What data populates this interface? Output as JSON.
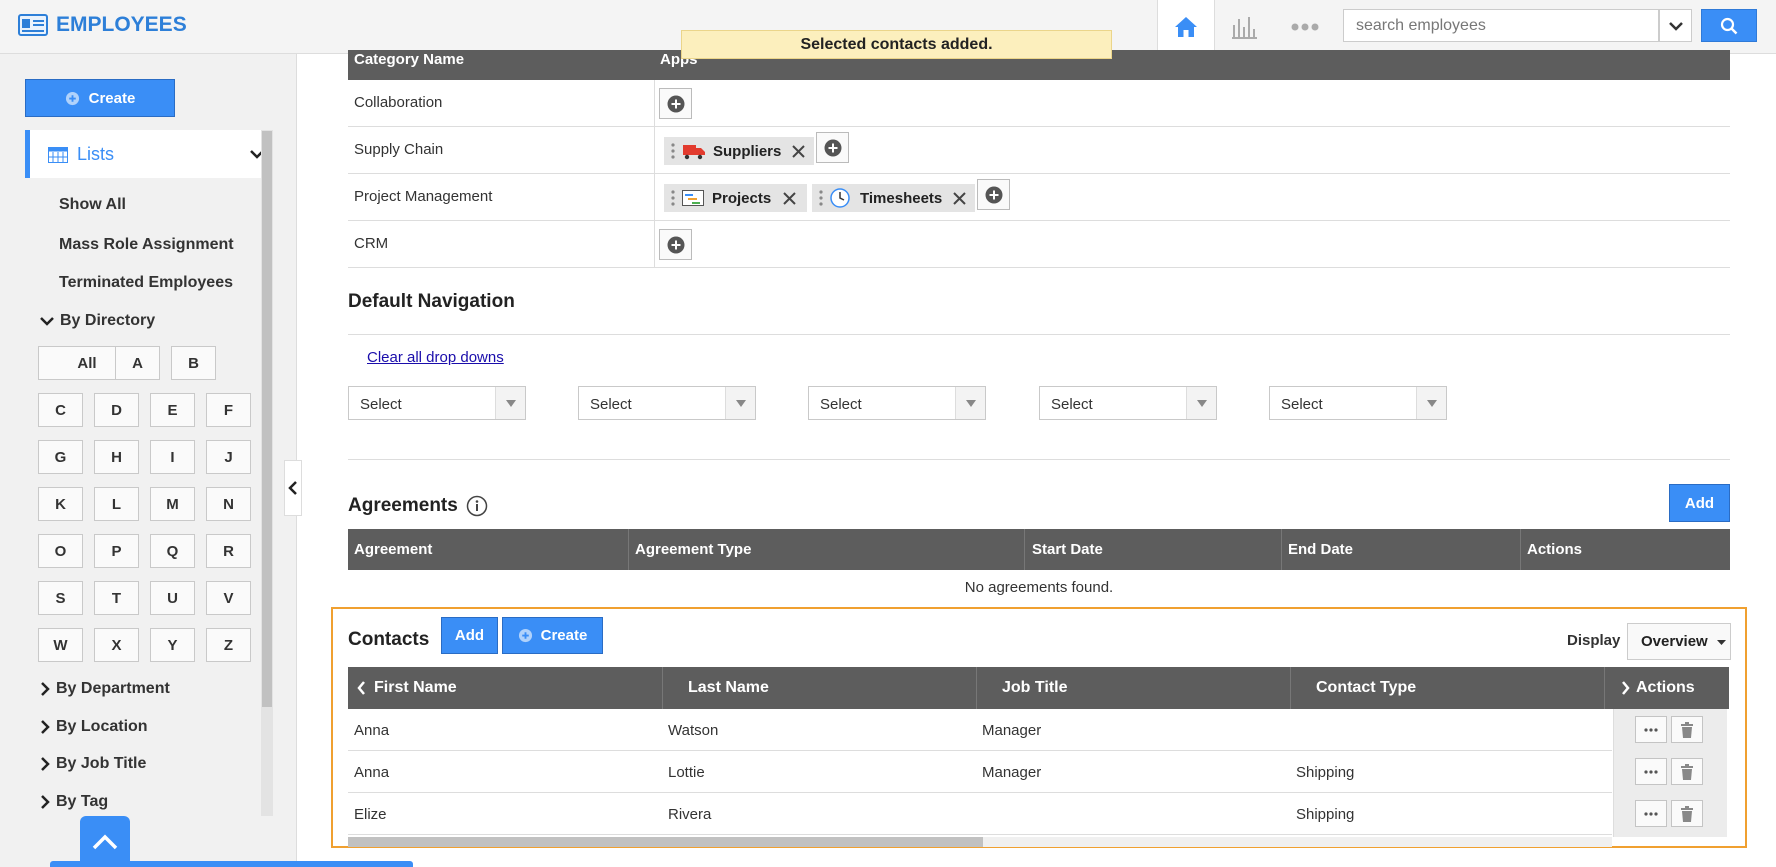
{
  "app": {
    "title": "EMPLOYEES"
  },
  "toast": "Selected contacts added.",
  "search": {
    "placeholder": "search employees"
  },
  "sidebar": {
    "create_label": "Create",
    "lists_label": "Lists",
    "items": [
      "Show All",
      "Mass Role Assignment",
      "Terminated Employees"
    ],
    "by_directory": "By Directory",
    "letters": [
      "All",
      "A",
      "B",
      "C",
      "D",
      "E",
      "F",
      "G",
      "H",
      "I",
      "J",
      "K",
      "L",
      "M",
      "N",
      "O",
      "P",
      "Q",
      "R",
      "S",
      "T",
      "U",
      "V",
      "W",
      "X",
      "Y",
      "Z"
    ],
    "groups": [
      "By Department",
      "By Location",
      "By Job Title",
      "By Tag"
    ]
  },
  "categories": {
    "headers": [
      "Category Name",
      "Apps"
    ],
    "rows": [
      {
        "name": "Collaboration",
        "apps": []
      },
      {
        "name": "Supply Chain",
        "apps": [
          "Suppliers"
        ]
      },
      {
        "name": "Project Management",
        "apps": [
          "Projects",
          "Timesheets"
        ]
      },
      {
        "name": "CRM",
        "apps": []
      }
    ]
  },
  "default_navigation": {
    "title": "Default Navigation",
    "clear_link": "Clear all drop downs",
    "selects": [
      "Select",
      "Select",
      "Select",
      "Select",
      "Select"
    ]
  },
  "agreements": {
    "title": "Agreements",
    "add_label": "Add",
    "headers": [
      "Agreement",
      "Agreement Type",
      "Start Date",
      "End Date",
      "Actions"
    ],
    "empty": "No agreements found."
  },
  "contacts": {
    "title": "Contacts",
    "add_label": "Add",
    "create_label": "Create",
    "display_label": "Display",
    "display_value": "Overview",
    "headers": [
      "First Name",
      "Last Name",
      "Job Title",
      "Contact Type",
      "Actions"
    ],
    "rows": [
      {
        "first": "Anna",
        "last": "Watson",
        "job": "Manager",
        "type": ""
      },
      {
        "first": "Anna",
        "last": "Lottie",
        "job": "Manager",
        "type": "Shipping"
      },
      {
        "first": "Elize",
        "last": "Rivera",
        "job": "",
        "type": "Shipping"
      }
    ]
  },
  "colors": {
    "accent": "#3a8ef6",
    "header_bg": "#5d5d5d",
    "toast_bg": "#fcefbd",
    "highlight": "#f0a030"
  }
}
